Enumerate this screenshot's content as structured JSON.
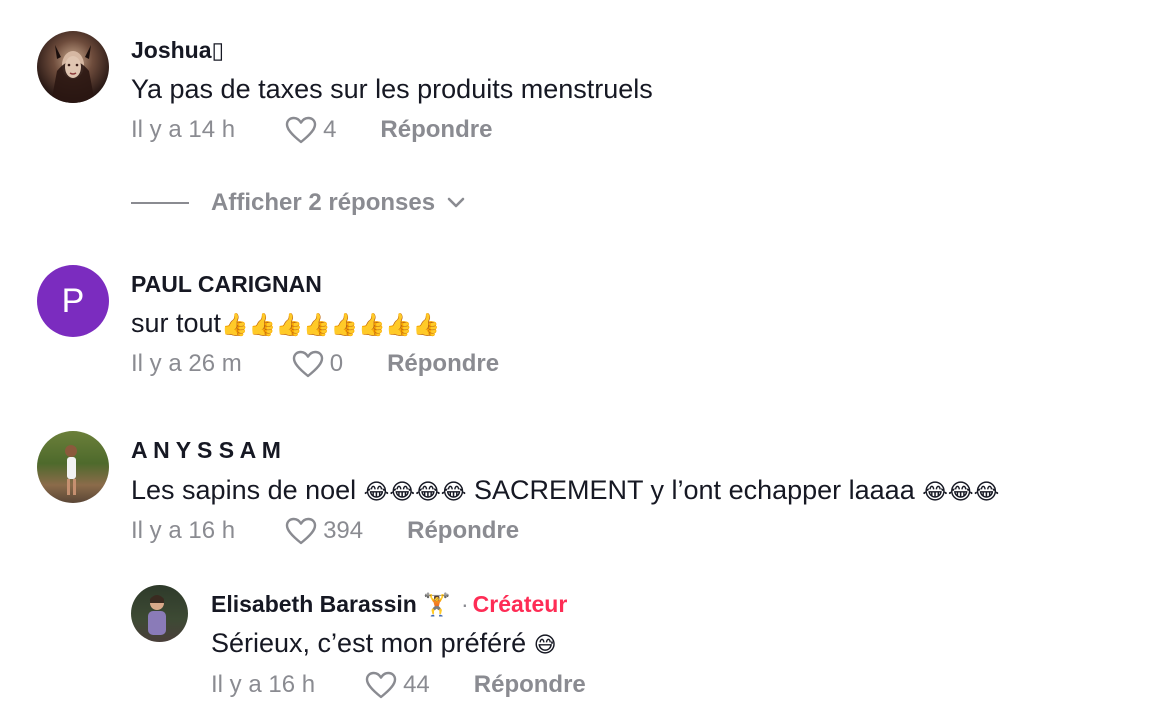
{
  "comments": [
    {
      "username": "Joshua▯",
      "text": "Ya pas de taxes sur les produits menstruels",
      "time": "Il y a 14 h",
      "likes": "4",
      "reply_label": "Répondre",
      "view_replies": "Afficher 2 réponses"
    },
    {
      "username": "PAUL CARIGNAN",
      "avatar_letter": "P",
      "text": "sur tout",
      "text_emoji": "👍👍👍👍👍👍👍👍",
      "time": "Il y a 26 m",
      "likes": "0",
      "reply_label": "Répondre"
    },
    {
      "username": "A N Y S S A M",
      "text_a": "Les sapins de noel ",
      "emoji_a": "😂😂😂😂",
      "text_b": " SACREMENT y l’ont echapper laaaa ",
      "emoji_b": "😂😂😂",
      "time": "Il y a 16 h",
      "likes": "394",
      "reply_label": "Répondre"
    },
    {
      "username": "Elisabeth Barassin",
      "username_emoji": "🏋",
      "creator_sep": "·",
      "creator_label": "Créateur",
      "text": "Sérieux, c’est mon préféré ",
      "text_emoji": "😅",
      "time": "Il y a 16 h",
      "likes": "44",
      "reply_label": "Répondre"
    }
  ],
  "colors": {
    "accent": "#fe2c55",
    "secondary_text": "#8a8b91",
    "avatar_purple": "#7b2cbf"
  }
}
